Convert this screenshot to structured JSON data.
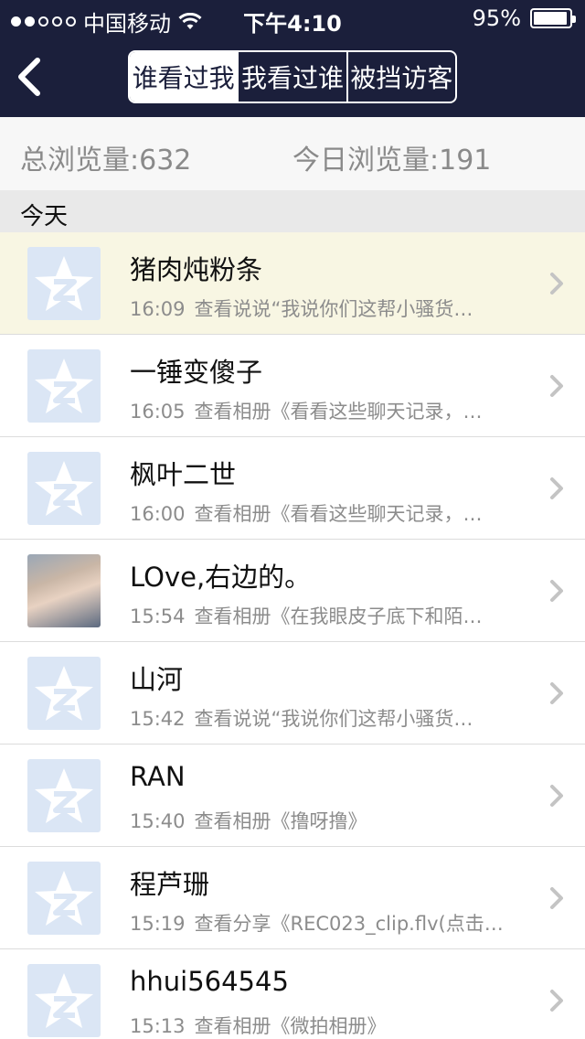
{
  "status_bar": {
    "carrier": "中国移动",
    "time": "下午4:10",
    "battery": "95%",
    "signal_filled": 2,
    "signal_total": 5
  },
  "nav": {
    "tabs": [
      {
        "label": "谁看过我",
        "active": true
      },
      {
        "label": "我看过谁",
        "active": false
      },
      {
        "label": "被挡访客",
        "active": false
      }
    ]
  },
  "stats": {
    "total_label": "总浏览量:632",
    "today_label": "今日浏览量:191"
  },
  "section": {
    "title": "今天"
  },
  "visitors": [
    {
      "name": "猪肉炖粉条",
      "time": "16:09",
      "action": "查看说说“我说你们这帮小骚货…",
      "avatar": "default"
    },
    {
      "name": "一锤变傻子",
      "time": "16:05",
      "action": "查看相册《看看这些聊天记录，…",
      "avatar": "default"
    },
    {
      "name": "枫叶二世",
      "time": "16:00",
      "action": "查看相册《看看这些聊天记录，…",
      "avatar": "default"
    },
    {
      "name": "LOve,右边的。",
      "time": "15:54",
      "action": "查看相册《在我眼皮子底下和陌…",
      "avatar": "photo"
    },
    {
      "name": "山河",
      "time": "15:42",
      "action": "查看说说“我说你们这帮小骚货…",
      "avatar": "default"
    },
    {
      "name": "RAN",
      "time": "15:40",
      "action": "查看相册《撸呀撸》",
      "avatar": "default"
    },
    {
      "name": "程芦珊",
      "time": "15:19",
      "action": "查看分享《REC023_clip.flv(点击…",
      "avatar": "default"
    },
    {
      "name": "hhui564545",
      "time": "15:13",
      "action": "查看相册《微拍相册》",
      "avatar": "default"
    }
  ],
  "colors": {
    "nav_bg": "#1b1f3b",
    "highlight_row": "#f8f6e3",
    "default_avatar_bg": "#dbe6f5"
  }
}
